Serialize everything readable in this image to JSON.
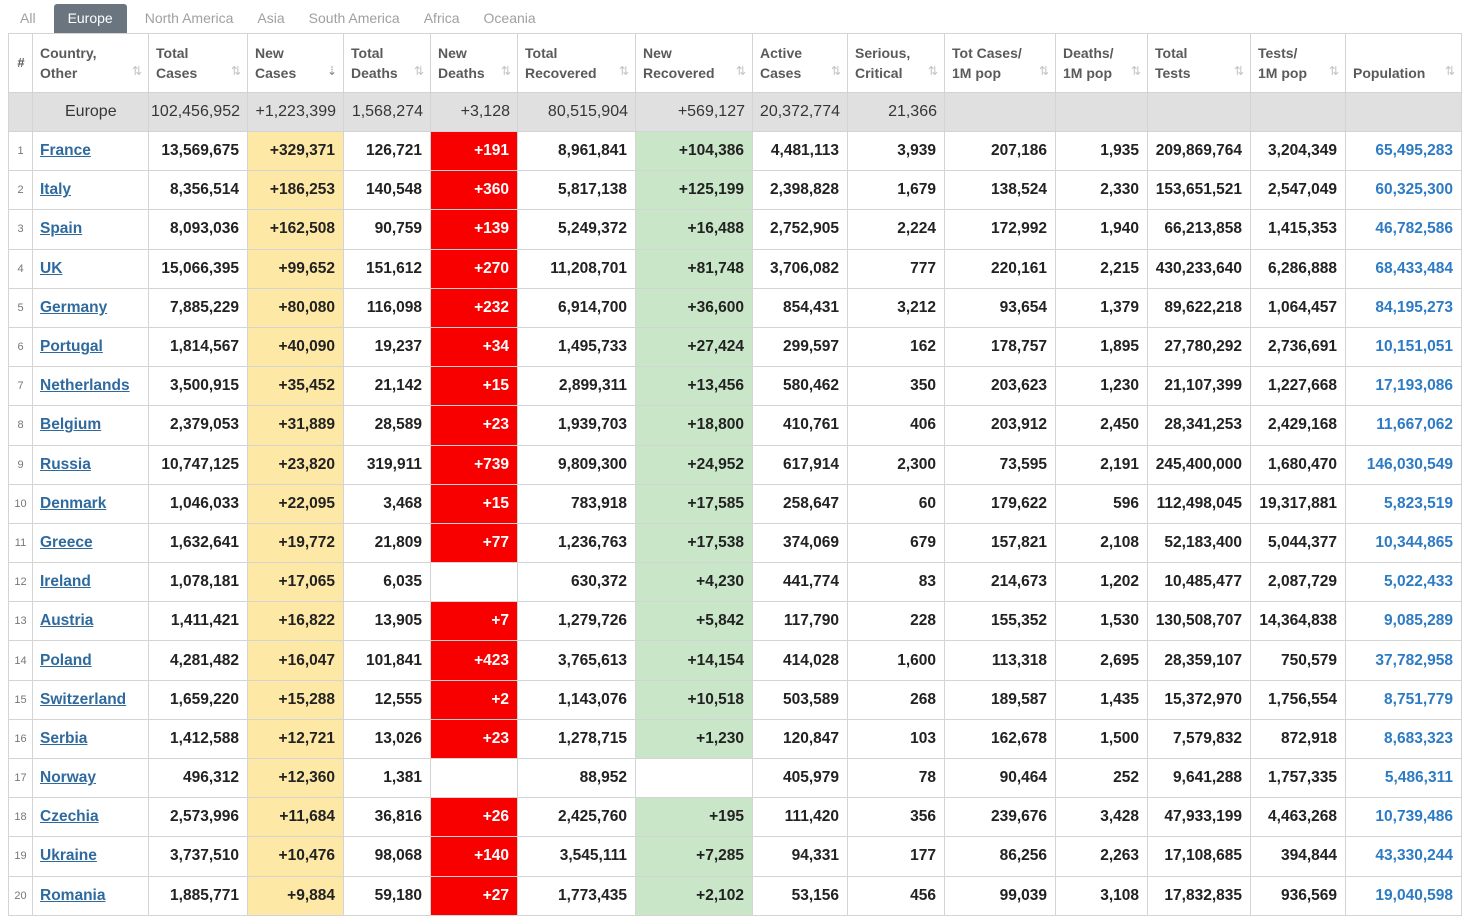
{
  "tabs": [
    "All",
    "Europe",
    "North America",
    "Asia",
    "South America",
    "Africa",
    "Oceania"
  ],
  "active_tab": "Europe",
  "colors": {
    "new_cases_bg": "#fde8a5",
    "new_deaths_bg": "#f80000",
    "new_recovered_bg": "#c9e6c9",
    "link": "#2f6a9e",
    "population": "#2d7bc4",
    "tab_active": "#6a7580"
  },
  "header": {
    "idx": "#",
    "country": [
      "Country,",
      "Other"
    ],
    "total_cases": [
      "Total",
      "Cases"
    ],
    "new_cases": [
      "New",
      "Cases"
    ],
    "total_deaths": [
      "Total",
      "Deaths"
    ],
    "new_deaths": [
      "New",
      "Deaths"
    ],
    "total_recovered": [
      "Total",
      "Recovered"
    ],
    "new_recovered": [
      "New",
      "Recovered"
    ],
    "active_cases": [
      "Active",
      "Cases"
    ],
    "serious": [
      "Serious,",
      "Critical"
    ],
    "tot_cases_1m": [
      "Tot Cases/",
      "1M pop"
    ],
    "deaths_1m": [
      "Deaths/",
      "1M pop"
    ],
    "total_tests": [
      "Total",
      "Tests"
    ],
    "tests_1m": [
      "Tests/",
      "1M pop"
    ],
    "population": "Population"
  },
  "total_row": {
    "name": "Europe",
    "total_cases": "102,456,952",
    "new_cases": "+1,223,399",
    "total_deaths": "1,568,274",
    "new_deaths": "+3,128",
    "total_recovered": "80,515,904",
    "new_recovered": "+569,127",
    "active_cases": "20,372,774",
    "serious": "21,366"
  },
  "rows": [
    {
      "idx": "1",
      "country": "France",
      "total_cases": "13,569,675",
      "new_cases": "+329,371",
      "total_deaths": "126,721",
      "new_deaths": "+191",
      "total_recovered": "8,961,841",
      "new_recovered": "+104,386",
      "active_cases": "4,481,113",
      "serious": "3,939",
      "tot_cases_1m": "207,186",
      "deaths_1m": "1,935",
      "total_tests": "209,869,764",
      "tests_1m": "3,204,349",
      "population": "65,495,283"
    },
    {
      "idx": "2",
      "country": "Italy",
      "total_cases": "8,356,514",
      "new_cases": "+186,253",
      "total_deaths": "140,548",
      "new_deaths": "+360",
      "total_recovered": "5,817,138",
      "new_recovered": "+125,199",
      "active_cases": "2,398,828",
      "serious": "1,679",
      "tot_cases_1m": "138,524",
      "deaths_1m": "2,330",
      "total_tests": "153,651,521",
      "tests_1m": "2,547,049",
      "population": "60,325,300"
    },
    {
      "idx": "3",
      "country": "Spain",
      "total_cases": "8,093,036",
      "new_cases": "+162,508",
      "total_deaths": "90,759",
      "new_deaths": "+139",
      "total_recovered": "5,249,372",
      "new_recovered": "+16,488",
      "active_cases": "2,752,905",
      "serious": "2,224",
      "tot_cases_1m": "172,992",
      "deaths_1m": "1,940",
      "total_tests": "66,213,858",
      "tests_1m": "1,415,353",
      "population": "46,782,586"
    },
    {
      "idx": "4",
      "country": "UK",
      "total_cases": "15,066,395",
      "new_cases": "+99,652",
      "total_deaths": "151,612",
      "new_deaths": "+270",
      "total_recovered": "11,208,701",
      "new_recovered": "+81,748",
      "active_cases": "3,706,082",
      "serious": "777",
      "tot_cases_1m": "220,161",
      "deaths_1m": "2,215",
      "total_tests": "430,233,640",
      "tests_1m": "6,286,888",
      "population": "68,433,484"
    },
    {
      "idx": "5",
      "country": "Germany",
      "total_cases": "7,885,229",
      "new_cases": "+80,080",
      "total_deaths": "116,098",
      "new_deaths": "+232",
      "total_recovered": "6,914,700",
      "new_recovered": "+36,600",
      "active_cases": "854,431",
      "serious": "3,212",
      "tot_cases_1m": "93,654",
      "deaths_1m": "1,379",
      "total_tests": "89,622,218",
      "tests_1m": "1,064,457",
      "population": "84,195,273"
    },
    {
      "idx": "6",
      "country": "Portugal",
      "total_cases": "1,814,567",
      "new_cases": "+40,090",
      "total_deaths": "19,237",
      "new_deaths": "+34",
      "total_recovered": "1,495,733",
      "new_recovered": "+27,424",
      "active_cases": "299,597",
      "serious": "162",
      "tot_cases_1m": "178,757",
      "deaths_1m": "1,895",
      "total_tests": "27,780,292",
      "tests_1m": "2,736,691",
      "population": "10,151,051"
    },
    {
      "idx": "7",
      "country": "Netherlands",
      "total_cases": "3,500,915",
      "new_cases": "+35,452",
      "total_deaths": "21,142",
      "new_deaths": "+15",
      "total_recovered": "2,899,311",
      "new_recovered": "+13,456",
      "active_cases": "580,462",
      "serious": "350",
      "tot_cases_1m": "203,623",
      "deaths_1m": "1,230",
      "total_tests": "21,107,399",
      "tests_1m": "1,227,668",
      "population": "17,193,086"
    },
    {
      "idx": "8",
      "country": "Belgium",
      "total_cases": "2,379,053",
      "new_cases": "+31,889",
      "total_deaths": "28,589",
      "new_deaths": "+23",
      "total_recovered": "1,939,703",
      "new_recovered": "+18,800",
      "active_cases": "410,761",
      "serious": "406",
      "tot_cases_1m": "203,912",
      "deaths_1m": "2,450",
      "total_tests": "28,341,253",
      "tests_1m": "2,429,168",
      "population": "11,667,062"
    },
    {
      "idx": "9",
      "country": "Russia",
      "total_cases": "10,747,125",
      "new_cases": "+23,820",
      "total_deaths": "319,911",
      "new_deaths": "+739",
      "total_recovered": "9,809,300",
      "new_recovered": "+24,952",
      "active_cases": "617,914",
      "serious": "2,300",
      "tot_cases_1m": "73,595",
      "deaths_1m": "2,191",
      "total_tests": "245,400,000",
      "tests_1m": "1,680,470",
      "population": "146,030,549"
    },
    {
      "idx": "10",
      "country": "Denmark",
      "total_cases": "1,046,033",
      "new_cases": "+22,095",
      "total_deaths": "3,468",
      "new_deaths": "+15",
      "total_recovered": "783,918",
      "new_recovered": "+17,585",
      "active_cases": "258,647",
      "serious": "60",
      "tot_cases_1m": "179,622",
      "deaths_1m": "596",
      "total_tests": "112,498,045",
      "tests_1m": "19,317,881",
      "population": "5,823,519"
    },
    {
      "idx": "11",
      "country": "Greece",
      "total_cases": "1,632,641",
      "new_cases": "+19,772",
      "total_deaths": "21,809",
      "new_deaths": "+77",
      "total_recovered": "1,236,763",
      "new_recovered": "+17,538",
      "active_cases": "374,069",
      "serious": "679",
      "tot_cases_1m": "157,821",
      "deaths_1m": "2,108",
      "total_tests": "52,183,400",
      "tests_1m": "5,044,377",
      "population": "10,344,865"
    },
    {
      "idx": "12",
      "country": "Ireland",
      "total_cases": "1,078,181",
      "new_cases": "+17,065",
      "total_deaths": "6,035",
      "new_deaths": "",
      "total_recovered": "630,372",
      "new_recovered": "+4,230",
      "active_cases": "441,774",
      "serious": "83",
      "tot_cases_1m": "214,673",
      "deaths_1m": "1,202",
      "total_tests": "10,485,477",
      "tests_1m": "2,087,729",
      "population": "5,022,433"
    },
    {
      "idx": "13",
      "country": "Austria",
      "total_cases": "1,411,421",
      "new_cases": "+16,822",
      "total_deaths": "13,905",
      "new_deaths": "+7",
      "total_recovered": "1,279,726",
      "new_recovered": "+5,842",
      "active_cases": "117,790",
      "serious": "228",
      "tot_cases_1m": "155,352",
      "deaths_1m": "1,530",
      "total_tests": "130,508,707",
      "tests_1m": "14,364,838",
      "population": "9,085,289"
    },
    {
      "idx": "14",
      "country": "Poland",
      "total_cases": "4,281,482",
      "new_cases": "+16,047",
      "total_deaths": "101,841",
      "new_deaths": "+423",
      "total_recovered": "3,765,613",
      "new_recovered": "+14,154",
      "active_cases": "414,028",
      "serious": "1,600",
      "tot_cases_1m": "113,318",
      "deaths_1m": "2,695",
      "total_tests": "28,359,107",
      "tests_1m": "750,579",
      "population": "37,782,958"
    },
    {
      "idx": "15",
      "country": "Switzerland",
      "total_cases": "1,659,220",
      "new_cases": "+15,288",
      "total_deaths": "12,555",
      "new_deaths": "+2",
      "total_recovered": "1,143,076",
      "new_recovered": "+10,518",
      "active_cases": "503,589",
      "serious": "268",
      "tot_cases_1m": "189,587",
      "deaths_1m": "1,435",
      "total_tests": "15,372,970",
      "tests_1m": "1,756,554",
      "population": "8,751,779"
    },
    {
      "idx": "16",
      "country": "Serbia",
      "total_cases": "1,412,588",
      "new_cases": "+12,721",
      "total_deaths": "13,026",
      "new_deaths": "+23",
      "total_recovered": "1,278,715",
      "new_recovered": "+1,230",
      "active_cases": "120,847",
      "serious": "103",
      "tot_cases_1m": "162,678",
      "deaths_1m": "1,500",
      "total_tests": "7,579,832",
      "tests_1m": "872,918",
      "population": "8,683,323"
    },
    {
      "idx": "17",
      "country": "Norway",
      "total_cases": "496,312",
      "new_cases": "+12,360",
      "total_deaths": "1,381",
      "new_deaths": "",
      "total_recovered": "88,952",
      "new_recovered": "",
      "active_cases": "405,979",
      "serious": "78",
      "tot_cases_1m": "90,464",
      "deaths_1m": "252",
      "total_tests": "9,641,288",
      "tests_1m": "1,757,335",
      "population": "5,486,311"
    },
    {
      "idx": "18",
      "country": "Czechia",
      "total_cases": "2,573,996",
      "new_cases": "+11,684",
      "total_deaths": "36,816",
      "new_deaths": "+26",
      "total_recovered": "2,425,760",
      "new_recovered": "+195",
      "active_cases": "111,420",
      "serious": "356",
      "tot_cases_1m": "239,676",
      "deaths_1m": "3,428",
      "total_tests": "47,933,199",
      "tests_1m": "4,463,268",
      "population": "10,739,486"
    },
    {
      "idx": "19",
      "country": "Ukraine",
      "total_cases": "3,737,510",
      "new_cases": "+10,476",
      "total_deaths": "98,068",
      "new_deaths": "+140",
      "total_recovered": "3,545,111",
      "new_recovered": "+7,285",
      "active_cases": "94,331",
      "serious": "177",
      "tot_cases_1m": "86,256",
      "deaths_1m": "2,263",
      "total_tests": "17,108,685",
      "tests_1m": "394,844",
      "population": "43,330,244"
    },
    {
      "idx": "20",
      "country": "Romania",
      "total_cases": "1,885,771",
      "new_cases": "+9,884",
      "total_deaths": "59,180",
      "new_deaths": "+27",
      "total_recovered": "1,773,435",
      "new_recovered": "+2,102",
      "active_cases": "53,156",
      "serious": "456",
      "tot_cases_1m": "99,039",
      "deaths_1m": "3,108",
      "total_tests": "17,832,835",
      "tests_1m": "936,569",
      "population": "19,040,598"
    }
  ]
}
